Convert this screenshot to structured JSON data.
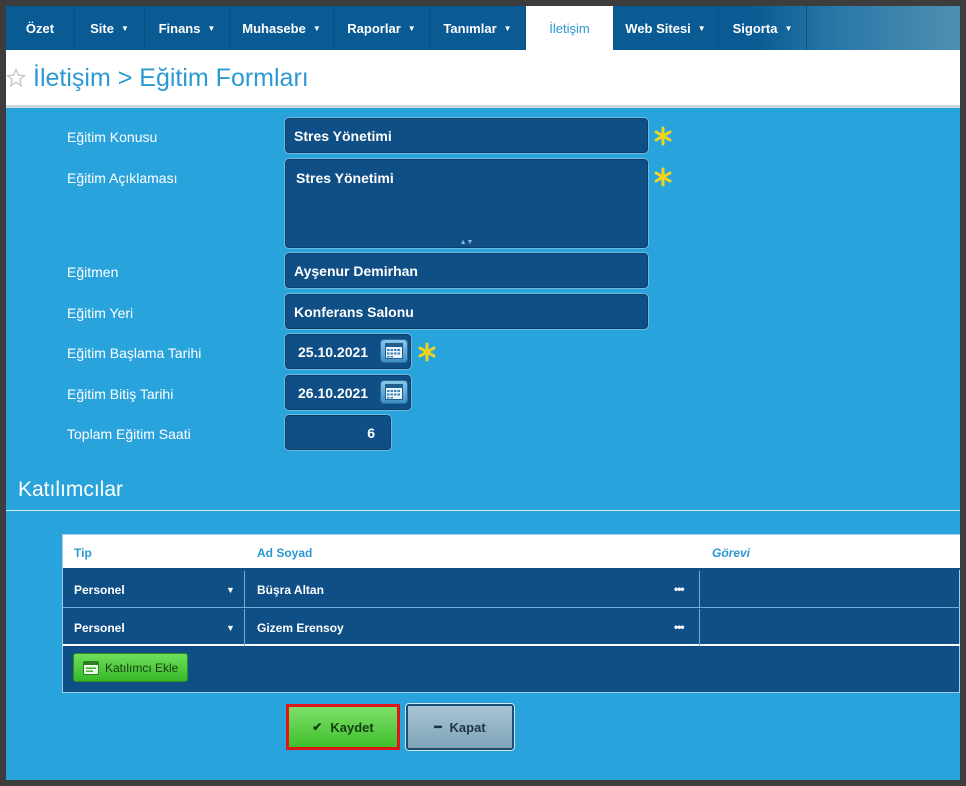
{
  "nav": {
    "items": [
      {
        "label": "Özet",
        "caret": false,
        "active": false
      },
      {
        "label": "Site",
        "caret": true,
        "active": false
      },
      {
        "label": "Finans",
        "caret": true,
        "active": false
      },
      {
        "label": "Muhasebe",
        "caret": true,
        "active": false
      },
      {
        "label": "Raporlar",
        "caret": true,
        "active": false
      },
      {
        "label": "Tanımlar",
        "caret": true,
        "active": false
      },
      {
        "label": "İletişim",
        "caret": false,
        "active": true
      },
      {
        "label": "Web Sitesi",
        "caret": true,
        "active": false
      },
      {
        "label": "Sigorta",
        "caret": true,
        "active": false
      }
    ]
  },
  "page": {
    "title": "İletişim > Eğitim Formları"
  },
  "form": {
    "konu_label": "Eğitim Konusu",
    "konu_value": "Stres Yönetimi",
    "aciklama_label": "Eğitim Açıklaması",
    "aciklama_value": "Stres Yönetimi",
    "egitmen_label": "Eğitmen",
    "egitmen_value": "Ayşenur Demirhan",
    "yer_label": "Eğitim Yeri",
    "yer_value": "Konferans Salonu",
    "baslama_label": "Eğitim Başlama Tarihi",
    "baslama_value": "25.10.2021",
    "bitis_label": "Eğitim Bitiş Tarihi",
    "bitis_value": "26.10.2021",
    "saat_label": "Toplam Eğitim Saati",
    "saat_value": "6"
  },
  "participants": {
    "section_title": "Katılımcılar",
    "columns": [
      "Tip",
      "Ad Soyad",
      "Görevi"
    ],
    "rows": [
      {
        "tip": "Personel",
        "ad_soyad": "Büşra Altan",
        "gorevi": ""
      },
      {
        "tip": "Personel",
        "ad_soyad": "Gizem Erensoy",
        "gorevi": ""
      }
    ],
    "add_button": "Katılımcı Ekle"
  },
  "actions": {
    "save": "Kaydet",
    "close": "Kapat"
  },
  "colors": {
    "nav_bg": "#0a5a93",
    "page_bg": "#29a3dc",
    "field_bg": "#0f4f86",
    "save_border": "#e0141b",
    "accent": "#2b9ad3"
  }
}
